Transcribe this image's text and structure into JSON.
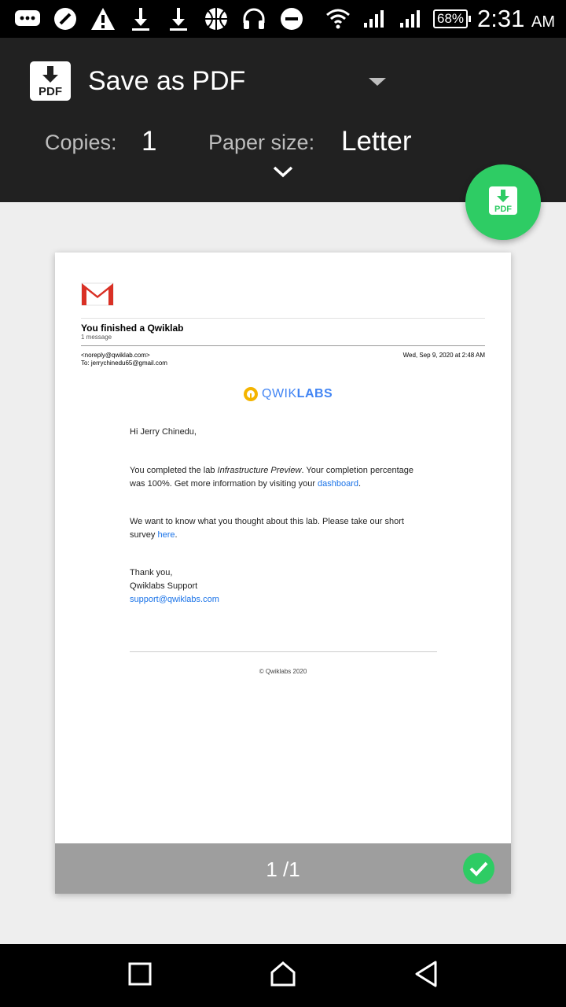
{
  "status_bar": {
    "battery": "68%",
    "time": "2:31",
    "ampm": "AM",
    "icons": [
      "messages-icon",
      "no-entry-icon",
      "warning-icon",
      "download-icon",
      "download-icon",
      "basketball-icon",
      "headset-icon",
      "do-not-disturb-icon",
      "wifi-icon",
      "signal-icon",
      "signal-icon"
    ]
  },
  "toolbar": {
    "destination": "Save as PDF",
    "copies_label": "Copies:",
    "copies_value": "1",
    "paper_label": "Paper size:",
    "paper_value": "Letter"
  },
  "fab": {
    "icon": "pdf-download-icon",
    "color": "#2ecc64"
  },
  "preview": {
    "email": {
      "subject": "You finished a Qwiklab",
      "count": "1 message",
      "from": "<noreply@qwiklab.com>",
      "to": "To: jerrychinedu65@gmail.com",
      "date": "Wed, Sep 9, 2020 at 2:48 AM",
      "logo_light": "QWIK",
      "logo_bold": "LABS",
      "greeting": "Hi Jerry Chinedu,",
      "p1_a": "You completed the lab ",
      "p1_lab": "Infrastructure Preview",
      "p1_b": ". Your completion percentage",
      "p1_c": "was 100%. Get more information by visiting your ",
      "p1_link": "dashboard",
      "p1_end": ".",
      "p2_a": "We want to know what you thought about this lab. Please take our short",
      "p2_b": "survey ",
      "p2_link": "here",
      "p2_end": ".",
      "thanks": "Thank you,",
      "signature": "Qwiklabs Support",
      "support_email": "support@qwiklabs.com",
      "copyright": "© Qwiklabs 2020"
    },
    "page_indicator": "1 /1"
  },
  "colors": {
    "toolbar": "#212121",
    "accent": "#2ecc64",
    "link": "#1a73e8"
  }
}
